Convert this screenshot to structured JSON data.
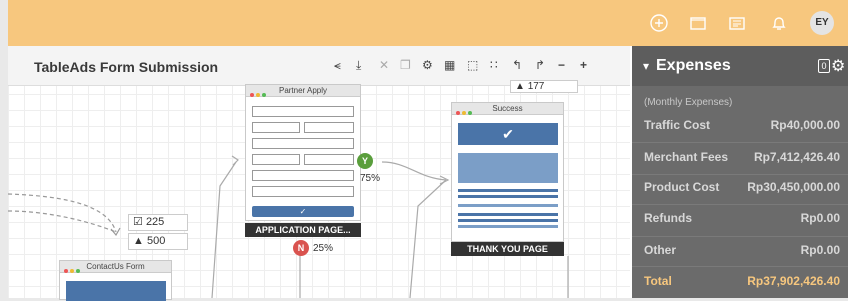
{
  "topbar": {
    "icons": [
      "plus-circle-icon",
      "folder-icon",
      "newspaper-icon",
      "bell-icon"
    ],
    "avatar_initials": "EY"
  },
  "canvas": {
    "title": "TableAds Form Submission",
    "toolbar_icons": [
      "share-icon",
      "download-icon",
      "close-icon",
      "copy-icon",
      "gear-icon",
      "calculator-icon",
      "fullscreen-icon",
      "grid-icon",
      "undo-icon",
      "redo-icon",
      "zoom-out-icon",
      "zoom-in-icon"
    ]
  },
  "nodes": {
    "partner_apply": {
      "title": "Partner Apply",
      "caption": "APPLICATION PAGE..."
    },
    "success": {
      "title": "Success",
      "caption": "THANK YOU PAGE",
      "visitors": "177"
    },
    "contact_form": {
      "title": "ContactUs Form",
      "count_checked": "225",
      "count_users": "500"
    }
  },
  "branches": {
    "yes_label": "Y",
    "yes_pct": "75%",
    "no_label": "N",
    "no_pct": "25%"
  },
  "expenses": {
    "title": "Expenses",
    "badge": "0",
    "subtitle": "(Monthly Expenses)",
    "rows": [
      {
        "label": "Traffic Cost",
        "value": "Rp40,000.00"
      },
      {
        "label": "Merchant Fees",
        "value": "Rp7,412,426.40"
      },
      {
        "label": "Product Cost",
        "value": "Rp30,450,000.00"
      },
      {
        "label": "Refunds",
        "value": "Rp0.00"
      },
      {
        "label": "Other",
        "value": "Rp0.00"
      }
    ],
    "total": {
      "label": "Total",
      "value": "Rp37,902,426.40"
    }
  }
}
